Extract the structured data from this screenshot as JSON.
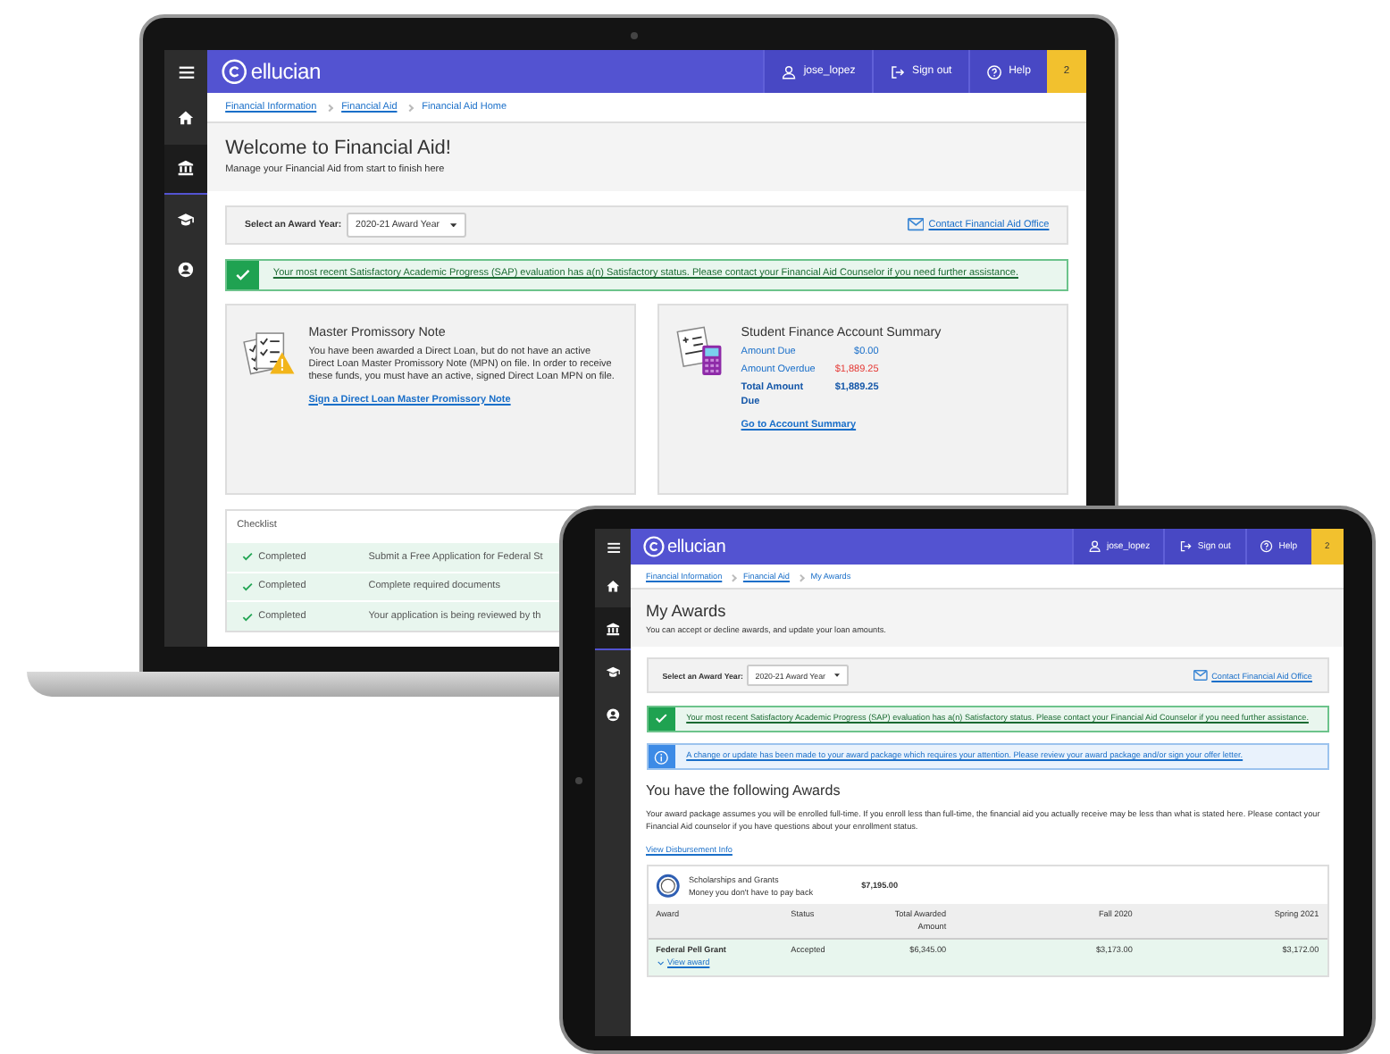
{
  "laptop": {
    "header": {
      "logo": "ellucian",
      "user": "jose_lopez",
      "sign_out": "Sign out",
      "help": "Help",
      "notifications": "2"
    },
    "sidebar": [
      {
        "selected": false
      },
      {
        "selected": true
      },
      {
        "selected": false
      },
      {
        "selected": false
      }
    ],
    "breadcrumbs": [
      {
        "label": "Financial Information",
        "kind": "link"
      },
      {
        "label": "Financial Aid",
        "kind": "link"
      },
      {
        "label": "Financial Aid Home",
        "kind": "current"
      }
    ],
    "title": "Welcome to Financial Aid!",
    "subtitle": "Manage your Financial Aid from start to finish here",
    "award_year": {
      "label": "Select an Award Year:",
      "value": "2020-21 Award Year"
    },
    "contact_link": "Contact Financial Aid Office",
    "sap_alert": "Your most recent Satisfactory Academic Progress (SAP) evaluation has a(n) Satisfactory status. Please contact your Financial Aid Counselor if you need further assistance.",
    "mpn_card": {
      "title": "Master Promissory Note",
      "body": "You have been awarded a Direct Loan, but do not have an active Direct Loan Master Promissory Note (MPN) on file. In order to receive these funds, you must have an active, signed Direct Loan MPN on file.",
      "link": "Sign a Direct Loan Master Promissory Note"
    },
    "account_card": {
      "title": "Student Finance Account Summary",
      "rows": [
        {
          "label": "Amount Due",
          "value": "$0.00",
          "kind": "normal"
        },
        {
          "label": "Amount Overdue",
          "value": "$1,889.25",
          "kind": "overdue"
        },
        {
          "label": "Total Amount Due",
          "value": "$1,889.25",
          "kind": "total"
        }
      ],
      "link": "Go to Account Summary"
    },
    "checklist": {
      "title": "Checklist",
      "rows": [
        {
          "status": "Completed",
          "completed": true,
          "task": "Submit a Free Application for Federal St"
        },
        {
          "status": "Completed",
          "completed": true,
          "task": "Complete required documents"
        },
        {
          "status": "Completed",
          "completed": true,
          "task": "Your application is being reviewed by th"
        }
      ]
    }
  },
  "tablet": {
    "header": {
      "logo": "ellucian",
      "user": "jose_lopez",
      "sign_out": "Sign out",
      "help": "Help",
      "notifications": "2"
    },
    "sidebar": [
      {
        "selected": false
      },
      {
        "selected": true
      },
      {
        "selected": false
      },
      {
        "selected": false
      }
    ],
    "breadcrumbs": [
      {
        "label": "Financial Information",
        "kind": "link"
      },
      {
        "label": "Financial Aid",
        "kind": "link"
      },
      {
        "label": "My Awards",
        "kind": "current"
      }
    ],
    "title": "My Awards",
    "subtitle": "You can accept or decline awards, and update your loan amounts.",
    "award_year": {
      "label": "Select an Award Year:",
      "value": "2020-21 Award Year"
    },
    "contact_link": "Contact Financial Aid Office",
    "sap_alert": "Your most recent Satisfactory Academic Progress (SAP) evaluation has a(n) Satisfactory status. Please contact your Financial Aid Counselor if you need further assistance.",
    "info_alert": "A change or update has been made to your award package which requires your attention. Please review your award package and/or sign your offer letter.",
    "awards": {
      "heading": "You have the following Awards",
      "note": "Your award package assumes you will be enrolled full-time. If you enroll less than full-time, the financial aid you actually receive may be less than what is stated here. Please contact your Financial Aid counselor if you have questions about your enrollment status.",
      "link": "View Disbursement Info",
      "category": {
        "title": "Scholarships and Grants",
        "subtitle": "Money you don't have to pay back",
        "total": "$7,195.00"
      },
      "columns": [
        "Award",
        "Status",
        "Total Awarded Amount",
        "Fall 2020",
        "Spring 2021"
      ],
      "rows": [
        {
          "award": "Federal Pell Grant",
          "link": "View award",
          "status": "Accepted",
          "total": "$6,345.00",
          "fall": "$3,173.00",
          "spring": "$3,172.00"
        }
      ]
    }
  }
}
